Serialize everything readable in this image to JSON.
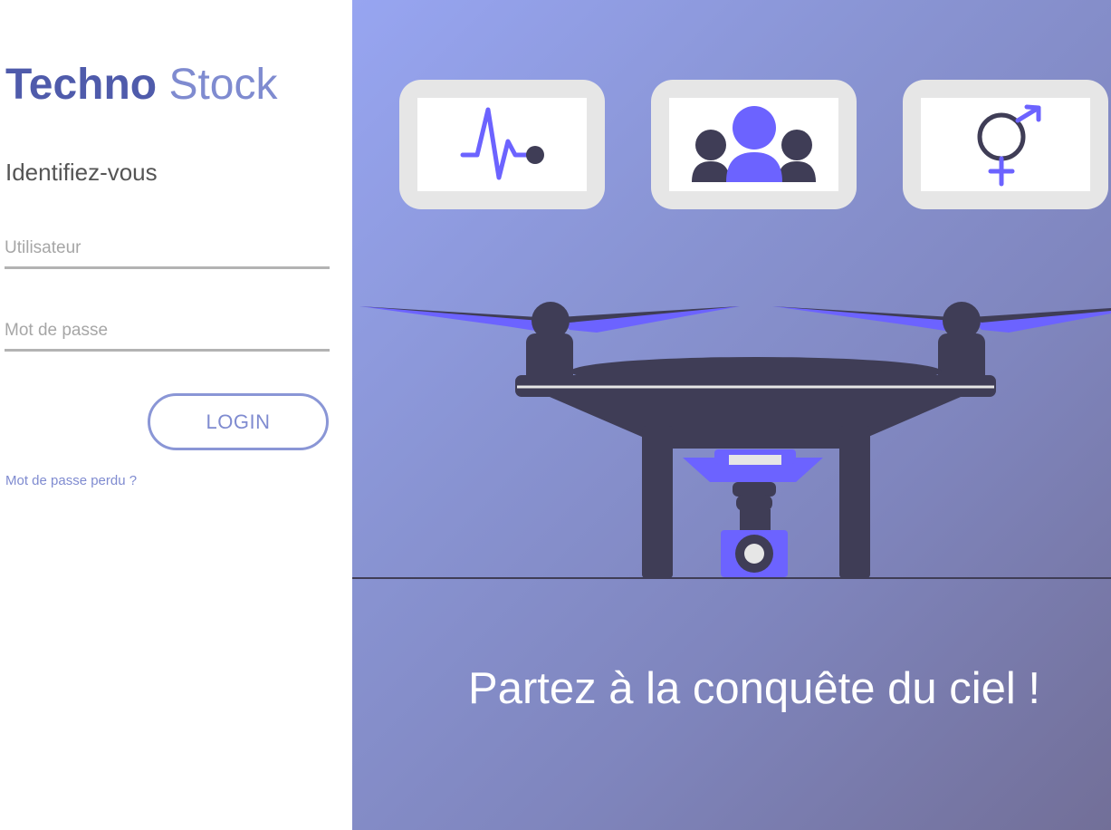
{
  "brand": {
    "name_strong": "Techno",
    "name_light": "Stock"
  },
  "login": {
    "heading": "Identifiez-vous",
    "username_placeholder": "Utilisateur",
    "password_placeholder": "Mot de passe",
    "submit_label": "LOGIN",
    "forgot_label": "Mot de passe perdu ?"
  },
  "hero": {
    "tagline": "Partez à la conquête du ciel !",
    "cards": [
      {
        "icon": "heartbeat-icon"
      },
      {
        "icon": "users-group-icon"
      },
      {
        "icon": "gender-icon"
      }
    ]
  },
  "colors": {
    "brand_dark": "#4f5bab",
    "brand_light": "#7f8bd0",
    "accent_purple": "#6c63ff",
    "drone_dark": "#3f3d56"
  }
}
